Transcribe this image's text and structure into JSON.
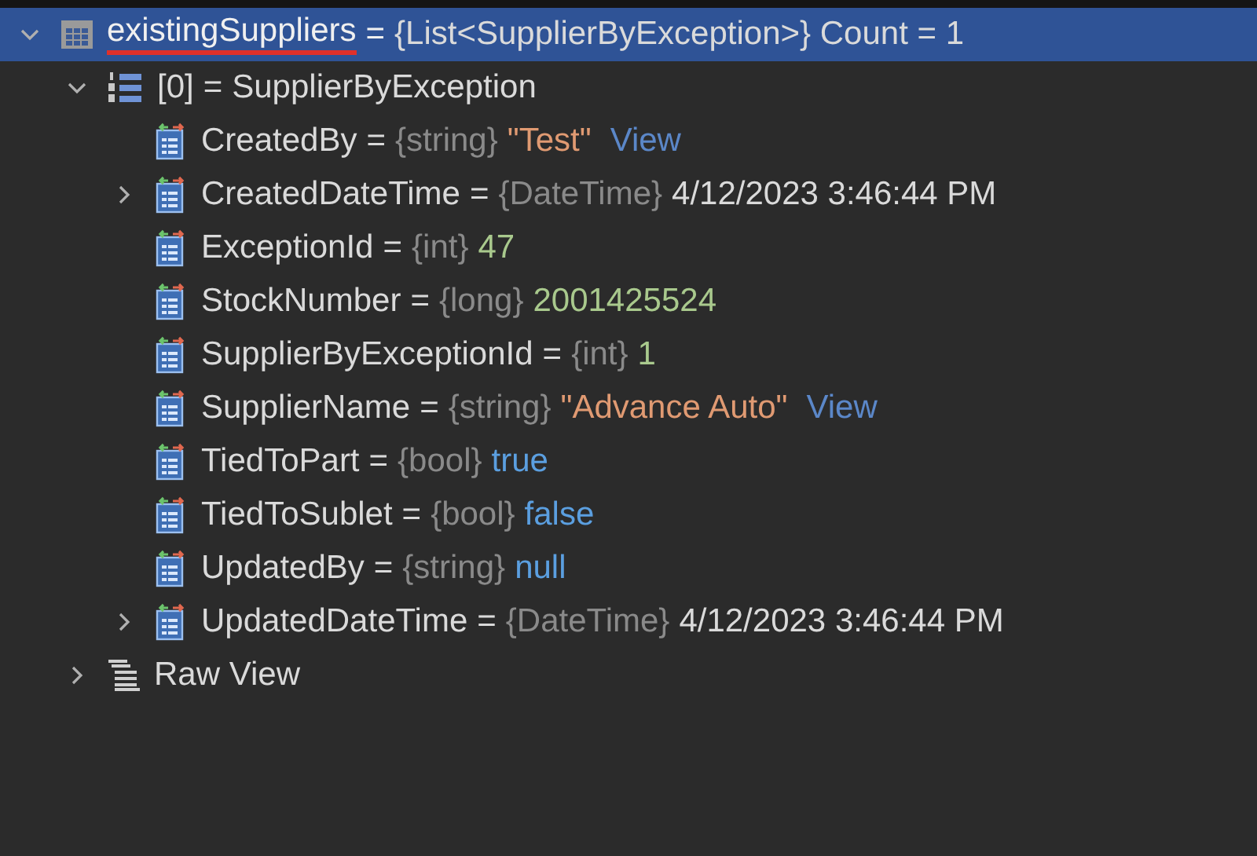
{
  "tree": [
    {
      "kind": "list",
      "name": "existingSuppliers",
      "sep": "=",
      "value": {
        "text": "{List<SupplierByException>} Count = 1",
        "kind": "plain"
      },
      "selected": true,
      "underlined": true,
      "expanded": true,
      "children": [
        {
          "kind": "array_item",
          "name": "[0]",
          "sep": "=",
          "value": {
            "text": "SupplierByException",
            "kind": "plain"
          },
          "selected": false,
          "expanded": true,
          "children": [
            {
              "kind": "field",
              "name": "CreatedBy",
              "sep": "=",
              "type": "{string}",
              "value": {
                "text": "\"Test\"",
                "kind": "string"
              },
              "link": "View",
              "selected": false
            },
            {
              "kind": "field",
              "name": "CreatedDateTime",
              "sep": "=",
              "type": "{DateTime}",
              "value": {
                "text": "4/12/2023 3:46:44 PM",
                "kind": "plain"
              },
              "selected": false,
              "expanded": false
            },
            {
              "kind": "field",
              "name": "ExceptionId",
              "sep": "=",
              "type": "{int}",
              "value": {
                "text": "47",
                "kind": "number"
              },
              "selected": false
            },
            {
              "kind": "field",
              "name": "StockNumber",
              "sep": "=",
              "type": "{long}",
              "value": {
                "text": "2001425524",
                "kind": "number"
              },
              "selected": false
            },
            {
              "kind": "field",
              "name": "SupplierByExceptionId",
              "sep": "=",
              "type": "{int}",
              "value": {
                "text": "1",
                "kind": "number"
              },
              "selected": false
            },
            {
              "kind": "field",
              "name": "SupplierName",
              "sep": "=",
              "type": "{string}",
              "value": {
                "text": "\"Advance Auto\"",
                "kind": "string"
              },
              "link": "View",
              "selected": false
            },
            {
              "kind": "field",
              "name": "TiedToPart",
              "sep": "=",
              "type": "{bool}",
              "value": {
                "text": "true",
                "kind": "keyword"
              },
              "selected": false
            },
            {
              "kind": "field",
              "name": "TiedToSublet",
              "sep": "=",
              "type": "{bool}",
              "value": {
                "text": "false",
                "kind": "keyword"
              },
              "selected": false
            },
            {
              "kind": "field",
              "name": "UpdatedBy",
              "sep": "=",
              "type": "{string}",
              "value": {
                "text": "null",
                "kind": "keyword"
              },
              "selected": false
            },
            {
              "kind": "field",
              "name": "UpdatedDateTime",
              "sep": "=",
              "type": "{DateTime}",
              "value": {
                "text": "4/12/2023 3:46:44 PM",
                "kind": "plain"
              },
              "selected": false,
              "expanded": false
            }
          ]
        },
        {
          "kind": "raw",
          "name": "Raw View",
          "selected": false,
          "expanded": false
        }
      ]
    }
  ]
}
